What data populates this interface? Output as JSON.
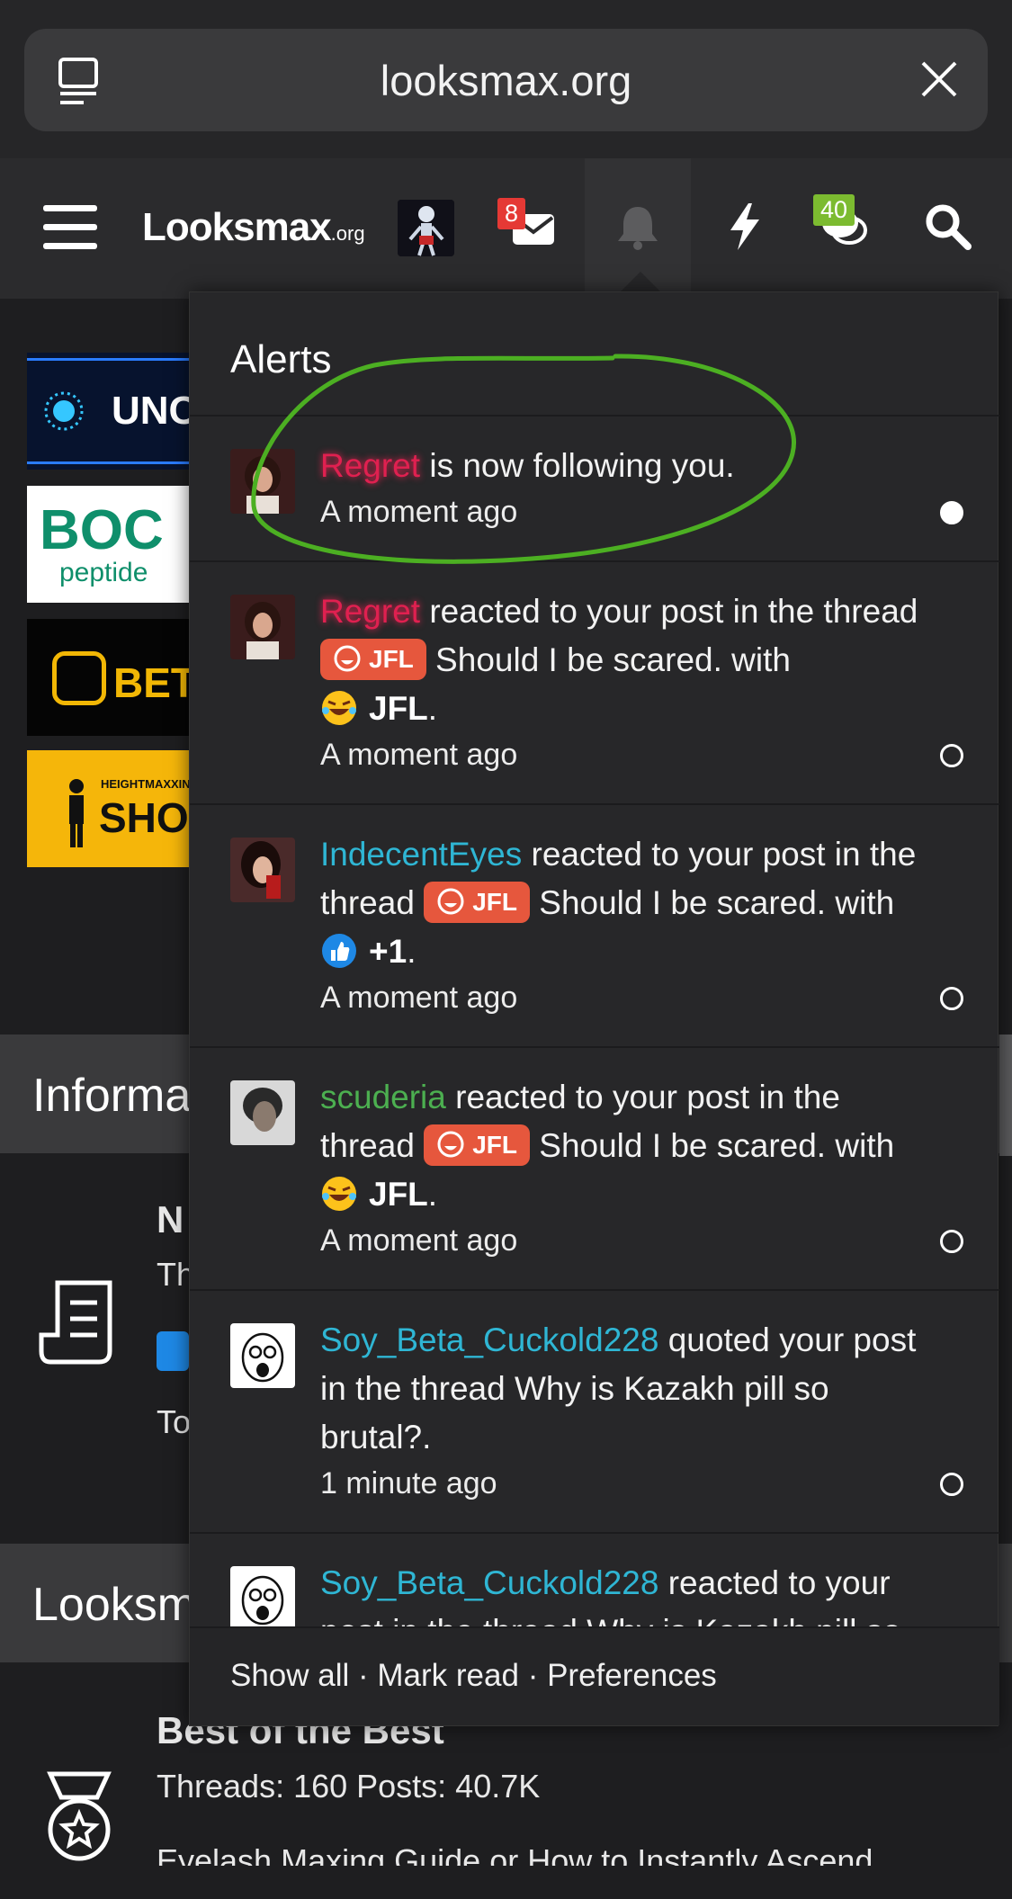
{
  "browser": {
    "url": "looksmax.org"
  },
  "header": {
    "logo_text": "Looksmax",
    "logo_suffix": ".org",
    "inbox_badge": "8",
    "chat_badge": "40",
    "colors": {
      "inbox_badge": "#e53935",
      "chat_badge": "#7cbb30"
    }
  },
  "background": {
    "ads": [
      "UNC",
      "BOC",
      "peptide",
      "BETR",
      "HEIGHTMAXXIN",
      "SHOES"
    ],
    "section1_title": "Informa",
    "section2_title": "Looksm",
    "node1_title": "N",
    "node1_line": "Th",
    "node1_line2": "To",
    "node2_title": "Best of the Best",
    "node2_stats": "Threads: 160 Posts: 40.7K",
    "node2_latest": "Eyelash Maxing Guide or How to Instantly Ascend"
  },
  "alerts": {
    "title": "Alerts",
    "items": [
      {
        "user": "Regret",
        "text": " is now following you.",
        "time": "A moment ago",
        "read": false
      },
      {
        "user": "Regret",
        "text1": " reacted to your post in the thread ",
        "prefix": "JFL",
        "thread": " Should I be scared.",
        "with": " with ",
        "reaction": "JFL",
        "time": "A moment ago",
        "read": true
      },
      {
        "user": "IndecentEyes",
        "text1": " reacted to your post in the thread ",
        "prefix": "JFL",
        "thread": " Should I be scared.",
        "with": " with ",
        "reaction": "+1",
        "time": "A moment ago",
        "read": true
      },
      {
        "user": "scuderia",
        "text1": " reacted to your post in the thread ",
        "prefix": "JFL",
        "thread": " Should I be scared.",
        "with": " with ",
        "reaction": "JFL",
        "time": "A moment ago",
        "read": true
      },
      {
        "user": "Soy_Beta_Cuckold228",
        "text": " quoted your post in the thread Why is Kazakh pill so brutal?.",
        "time": "1 minute ago",
        "read": true
      },
      {
        "user": "Soy_Beta_Cuckold228",
        "text": " reacted to your post in the thread Why is Kazakh pill so",
        "time": "",
        "read": true
      }
    ],
    "footer": {
      "show_all": "Show all",
      "sep": " · ",
      "mark_read": "Mark read",
      "preferences": "Preferences"
    }
  }
}
